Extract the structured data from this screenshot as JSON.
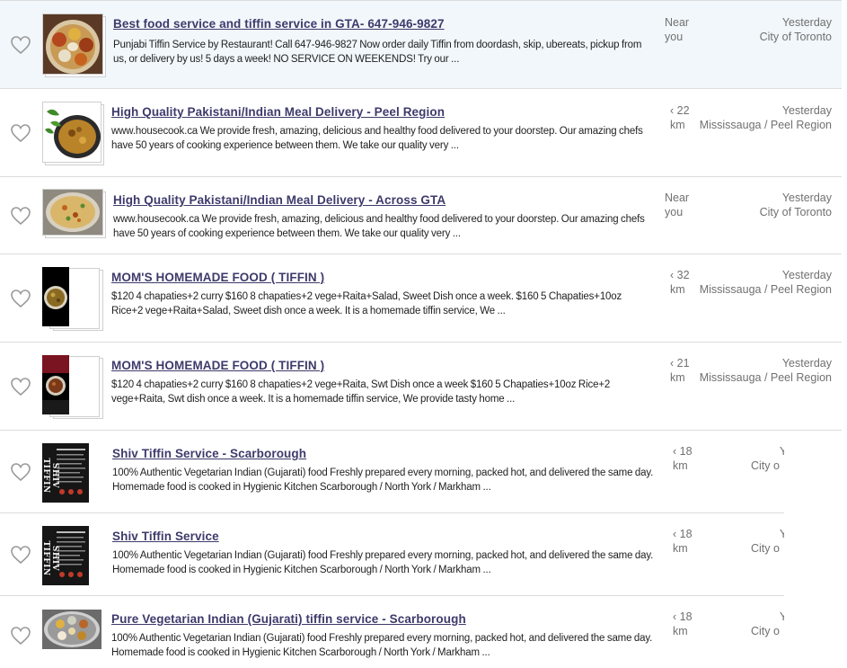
{
  "listings": [
    {
      "title": "Best food service and tiffin service in GTA- 647-946-9827",
      "description": "Punjabi Tiffin Service by Restaurant! Call 647-946-9827 Now order daily Tiffin from doordash, skip, ubereats, pickup from us, or delivery by us! 5 days a week! NO SERVICE ON WEEKENDS! Try our ...",
      "distance_line1": "Near",
      "distance_line2": "you",
      "posted": "Yesterday",
      "location": "City of Toronto",
      "featured": true
    },
    {
      "title": "High Quality Pakistani/Indian Meal Delivery - Peel Region",
      "description": "www.housecook.ca We provide fresh, amazing, delicious and healthy food delivered to your doorstep. Our amazing chefs have 50 years of cooking experience between them. We take our quality very ...",
      "distance_line1": "‹ 22",
      "distance_line2": "km",
      "posted": "Yesterday",
      "location": "Mississauga / Peel Region",
      "featured": false
    },
    {
      "title": "High Quality Pakistani/Indian Meal Delivery - Across GTA",
      "description": "www.housecook.ca We provide fresh, amazing, delicious and healthy food delivered to your doorstep. Our amazing chefs have 50 years of cooking experience between them. We take our quality very ...",
      "distance_line1": "Near",
      "distance_line2": "you",
      "posted": "Yesterday",
      "location": "City of Toronto",
      "featured": false
    },
    {
      "title": "MOM'S HOMEMADE FOOD ( TIFFIN )",
      "description": "$120 4 chapaties+2 curry $160 8 chapaties+2 vege+Raita+Salad, Sweet Dish once a week. $160 5 Chapaties+10oz Rice+2 vege+Raita+Salad, Sweet dish once a week. It is a homemade tiffin service, We ...",
      "distance_line1": "‹ 32",
      "distance_line2": "km",
      "posted": "Yesterday",
      "location": "Mississauga / Peel Region",
      "featured": false
    },
    {
      "title": "MOM'S HOMEMADE FOOD ( TIFFIN )",
      "description": "$120 4 chapaties+2 curry $160 8 chapaties+2 vege+Raita, Swt Dish once a week $160 5 Chapaties+10oz Rice+2 vege+Raita, Swt dish once a week. It is a homemade tiffin service, We provide tasty home ...",
      "distance_line1": "‹ 21",
      "distance_line2": "km",
      "posted": "Yesterday",
      "location": "Mississauga / Peel Region",
      "featured": false
    },
    {
      "title": "Shiv Tiffin Service - Scarborough",
      "description": "100% Authentic Vegetarian Indian (Gujarati) food Freshly prepared every morning, packed hot, and delivered the same day. Homemade food is cooked in Hygienic Kitchen Scarborough / North York / Markham ...",
      "distance_line1": "‹ 18",
      "distance_line2": "km",
      "posted": "Y",
      "location": "City o",
      "featured": false
    },
    {
      "title": "Shiv Tiffin Service",
      "description": "100% Authentic Vegetarian Indian (Gujarati) food Freshly prepared every morning, packed hot, and delivered the same day. Homemade food is cooked in Hygienic Kitchen Scarborough / North York / Markham ...",
      "distance_line1": "‹ 18",
      "distance_line2": "km",
      "posted": "Y",
      "location": "City o",
      "featured": false
    },
    {
      "title": "Pure Vegetarian Indian (Gujarati) tiffin service - Scarborough",
      "description": "100% Authentic Vegetarian Indian (Gujarati) food Freshly prepared every morning, packed hot, and delivered the same day. Homemade food is cooked in Hygienic Kitchen Scarborough / North York / Markham ...",
      "distance_line1": "‹ 18",
      "distance_line2": "km",
      "posted": "Y",
      "location": "City o",
      "featured": false
    }
  ],
  "thumbnail_labels": {
    "shiv_logo_text": "SHIV TIFFIN"
  },
  "colors": {
    "title": "#3e3a6b",
    "featured_bg": "#f1f7fb",
    "meta_text": "#707070",
    "divider": "#dcdcdc",
    "heart_outline": "#9a9a9a"
  },
  "icons": {
    "favorite": "heart-outline-icon"
  }
}
